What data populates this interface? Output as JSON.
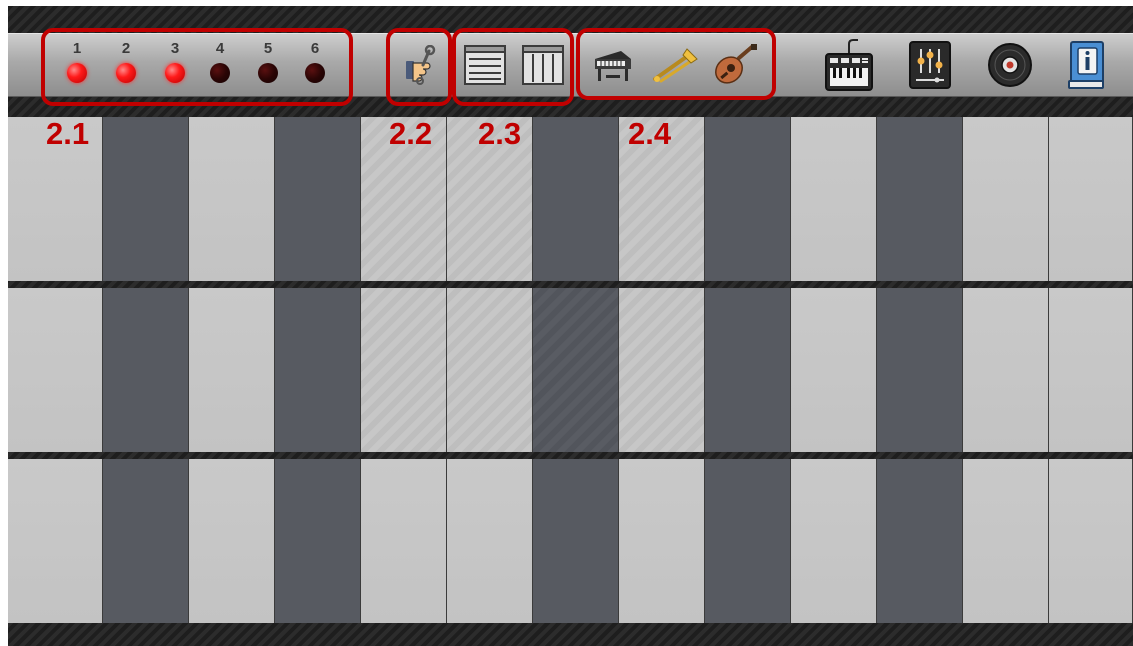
{
  "tracks": [
    {
      "label": "1",
      "active": true
    },
    {
      "label": "2",
      "active": true
    },
    {
      "label": "3",
      "active": true
    },
    {
      "label": "4",
      "active": false
    },
    {
      "label": "5",
      "active": false
    },
    {
      "label": "6",
      "active": false
    }
  ],
  "callouts": {
    "track_leds": "2.1",
    "settings": "2.2",
    "layout": "2.3",
    "instruments": "2.4"
  },
  "icons": {
    "settings": "wrench-hand-icon",
    "layout_rows": "horizontal-layout-icon",
    "layout_columns": "vertical-layout-icon",
    "piano": "grand-piano-icon",
    "trombone": "trombone-icon",
    "guitar": "acoustic-guitar-icon",
    "keyboard": "synth-keyboard-icon",
    "mixer": "mixer-sliders-icon",
    "record": "vinyl-record-icon",
    "info": "info-book-icon"
  },
  "colors": {
    "callout": "#c00000",
    "led_on": "#ff1a1a",
    "led_off": "#2a0505",
    "key_light": "#c6c6c6",
    "key_dark": "#575a61"
  },
  "pad_grid": {
    "rows": 3,
    "columns": 13,
    "pattern": [
      "light",
      "dark",
      "light",
      "dark",
      "light",
      "light",
      "dark",
      "light",
      "dark",
      "light",
      "dark",
      "light",
      "light"
    ]
  }
}
